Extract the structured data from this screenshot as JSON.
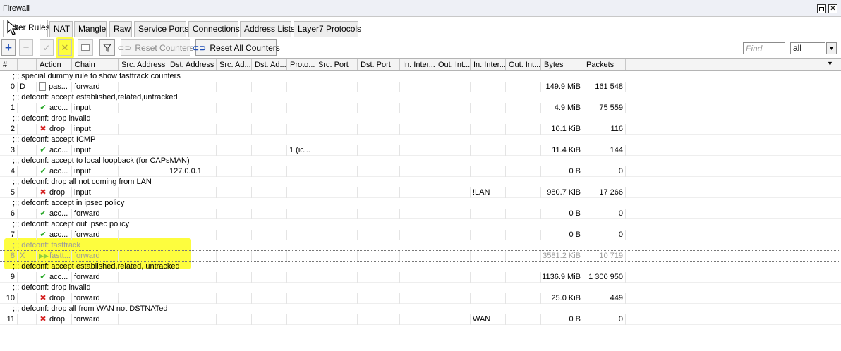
{
  "window": {
    "title": "Firewall"
  },
  "tabs": [
    {
      "label": "Filter Rules"
    },
    {
      "label": "NAT"
    },
    {
      "label": "Mangle"
    },
    {
      "label": "Raw"
    },
    {
      "label": "Service Ports"
    },
    {
      "label": "Connections"
    },
    {
      "label": "Address Lists"
    },
    {
      "label": "Layer7 Protocols"
    }
  ],
  "toolbar": {
    "add_icon": "plus-icon",
    "remove_icon": "minus-icon",
    "enable_icon": "check-icon",
    "disable_icon": "cross-icon",
    "comment_icon": "comment-icon",
    "filter_icon": "funnel-icon",
    "reset_counters_label": "Reset Counters",
    "reset_all_counters_label": "Reset All Counters",
    "find_placeholder": "Find",
    "filter_value": "all"
  },
  "columns": [
    "#",
    "",
    "Action",
    "Chain",
    "Src. Address",
    "Dst. Address",
    "Src. Ad...",
    "Dst. Ad...",
    "Proto...",
    "Src. Port",
    "Dst. Port",
    "In. Inter...",
    "Out. Int...",
    "In. Inter...",
    "Out. Int...",
    "Bytes",
    "Packets"
  ],
  "rows": [
    {
      "type": "comment",
      "text": ";;; special dummy rule to show fasttrack counters"
    },
    {
      "type": "rule",
      "num": "0",
      "flag": "D",
      "icon": "pass-icon",
      "action": "pas...",
      "chain": "forward",
      "src": "",
      "dst": "",
      "proto": "",
      "in_if": "",
      "bytes": "149.9 MiB",
      "packets": "161 548"
    },
    {
      "type": "comment",
      "text": ";;; defconf: accept established,related,untracked"
    },
    {
      "type": "rule",
      "num": "1",
      "flag": "",
      "icon": "accept-icon",
      "action": "acc...",
      "chain": "input",
      "src": "",
      "dst": "",
      "proto": "",
      "in_if": "",
      "bytes": "4.9 MiB",
      "packets": "75 559"
    },
    {
      "type": "comment",
      "text": ";;; defconf: drop invalid"
    },
    {
      "type": "rule",
      "num": "2",
      "flag": "",
      "icon": "drop-icon",
      "action": "drop",
      "chain": "input",
      "src": "",
      "dst": "",
      "proto": "",
      "in_if": "",
      "bytes": "10.1 KiB",
      "packets": "116"
    },
    {
      "type": "comment",
      "text": ";;; defconf: accept ICMP"
    },
    {
      "type": "rule",
      "num": "3",
      "flag": "",
      "icon": "accept-icon",
      "action": "acc...",
      "chain": "input",
      "src": "",
      "dst": "",
      "proto": "1 (ic...",
      "in_if": "",
      "bytes": "11.4 KiB",
      "packets": "144"
    },
    {
      "type": "comment",
      "text": ";;; defconf: accept to local loopback (for CAPsMAN)"
    },
    {
      "type": "rule",
      "num": "4",
      "flag": "",
      "icon": "accept-icon",
      "action": "acc...",
      "chain": "input",
      "src": "",
      "dst": "127.0.0.1",
      "proto": "",
      "in_if": "",
      "bytes": "0 B",
      "packets": "0"
    },
    {
      "type": "comment",
      "text": ";;; defconf: drop all not coming from LAN"
    },
    {
      "type": "rule",
      "num": "5",
      "flag": "",
      "icon": "drop-icon",
      "action": "drop",
      "chain": "input",
      "src": "",
      "dst": "",
      "proto": "",
      "in_if": "!LAN",
      "bytes": "980.7 KiB",
      "packets": "17 266"
    },
    {
      "type": "comment",
      "text": ";;; defconf: accept in ipsec policy"
    },
    {
      "type": "rule",
      "num": "6",
      "flag": "",
      "icon": "accept-icon",
      "action": "acc...",
      "chain": "forward",
      "src": "",
      "dst": "",
      "proto": "",
      "in_if": "",
      "bytes": "0 B",
      "packets": "0"
    },
    {
      "type": "comment",
      "text": ";;; defconf: accept out ipsec policy"
    },
    {
      "type": "rule",
      "num": "7",
      "flag": "",
      "icon": "accept-icon",
      "action": "acc...",
      "chain": "forward",
      "src": "",
      "dst": "",
      "proto": "",
      "in_if": "",
      "bytes": "0 B",
      "packets": "0"
    },
    {
      "type": "comment",
      "text": ";;; defconf: fasttrack",
      "disabled": true
    },
    {
      "type": "rule",
      "num": "8",
      "flag": "X",
      "icon": "fasttrack-icon",
      "action": "fastt...",
      "chain": "forward",
      "src": "",
      "dst": "",
      "proto": "",
      "in_if": "",
      "bytes": "3581.2 KiB",
      "packets": "10 719",
      "disabled": true
    },
    {
      "type": "comment",
      "text": ";;; defconf: accept established,related, untracked"
    },
    {
      "type": "rule",
      "num": "9",
      "flag": "",
      "icon": "accept-icon",
      "action": "acc...",
      "chain": "forward",
      "src": "",
      "dst": "",
      "proto": "",
      "in_if": "",
      "bytes": "1136.9 MiB",
      "packets": "1 300 950"
    },
    {
      "type": "comment",
      "text": ";;; defconf: drop invalid"
    },
    {
      "type": "rule",
      "num": "10",
      "flag": "",
      "icon": "drop-icon",
      "action": "drop",
      "chain": "forward",
      "src": "",
      "dst": "",
      "proto": "",
      "in_if": "",
      "bytes": "25.0 KiB",
      "packets": "449"
    },
    {
      "type": "comment",
      "text": ";;; defconf: drop all from WAN not DSTNATed"
    },
    {
      "type": "rule",
      "num": "11",
      "flag": "",
      "icon": "drop-icon",
      "action": "drop",
      "chain": "forward",
      "src": "",
      "dst": "",
      "proto": "",
      "in_if": "WAN",
      "bytes": "0 B",
      "packets": "0"
    }
  ],
  "colors": {
    "highlight": "#fdfd1c",
    "accept": "#2aa82a",
    "drop": "#d42020",
    "disabled_text": "#9c9c9c"
  }
}
